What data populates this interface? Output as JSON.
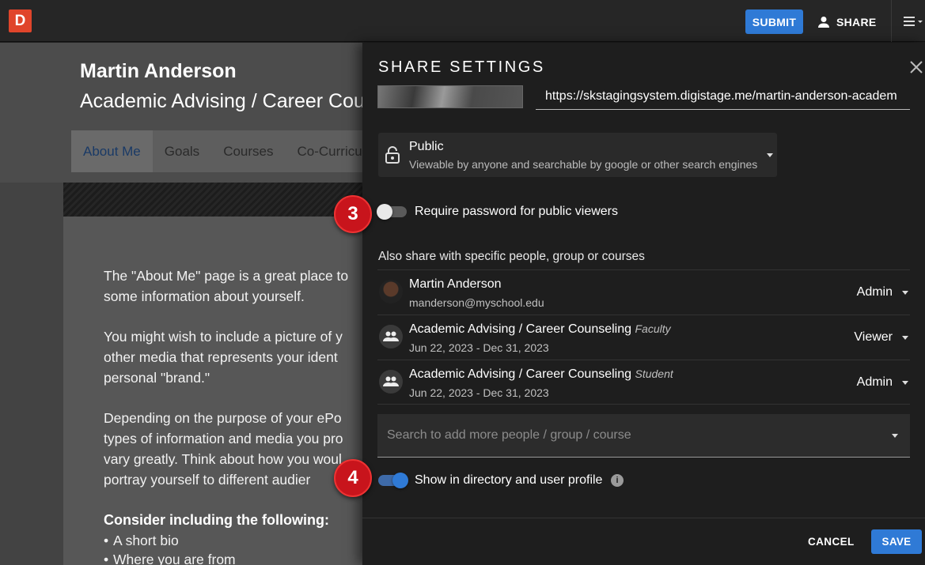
{
  "topbar": {
    "logo": "D",
    "submit_label": "SUBMIT",
    "share_label": "SHARE",
    "icons": [
      "person-icon",
      "hamburger-menu-icon"
    ]
  },
  "background_page": {
    "name": "Martin Anderson",
    "course": "Academic Advising / Career Cou",
    "tabs": [
      "About Me",
      "Goals",
      "Courses",
      "Co-Curricula"
    ],
    "active_tab": "About Me",
    "paragraphs": [
      [
        "The \"About Me\" page is a great place to",
        "some information about yourself."
      ],
      [
        "You might wish to include a picture of y",
        "other media that represents your ident",
        "personal \"brand.\""
      ],
      [
        "Depending on the purpose of your ePo",
        "types of information and media you pro",
        "vary greatly. Think about how you woul",
        "portray yourself to different audier"
      ]
    ],
    "heading": "Consider including the following:",
    "list": [
      "A short bio",
      "Where you are from"
    ]
  },
  "dialog": {
    "title": "SHARE SETTINGS",
    "url": "https://skstagingsystem.digistage.me/martin-anderson-academ",
    "visibility": {
      "title": "Public",
      "subtitle": "Viewable by anyone and searchable by google or other search engines"
    },
    "require_password_label": "Require password for public viewers",
    "require_password_on": false,
    "also_share_label": "Also share with specific people, group or courses",
    "members": [
      {
        "name": "Martin Anderson",
        "tag": "",
        "sub": "manderson@myschool.edu",
        "role": "Admin",
        "avatar": "photo"
      },
      {
        "name": "Academic Advising / Career Counseling",
        "tag": "Faculty",
        "sub": "Jun 22, 2023 - Dec 31, 2023",
        "role": "Viewer",
        "avatar": "group-icon"
      },
      {
        "name": "Academic Advising / Career Counseling",
        "tag": "Student",
        "sub": "Jun 22, 2023 - Dec 31, 2023",
        "role": "Admin",
        "avatar": "group-icon"
      }
    ],
    "search_placeholder": "Search to add more people / group / course",
    "directory_label": "Show in directory and user profile",
    "directory_on": true,
    "cancel_label": "CANCEL",
    "save_label": "SAVE"
  },
  "callouts": [
    "3",
    "4"
  ],
  "colors": {
    "accent": "#2f7ad6",
    "logo": "#e0452b",
    "callout": "#c8141c"
  }
}
